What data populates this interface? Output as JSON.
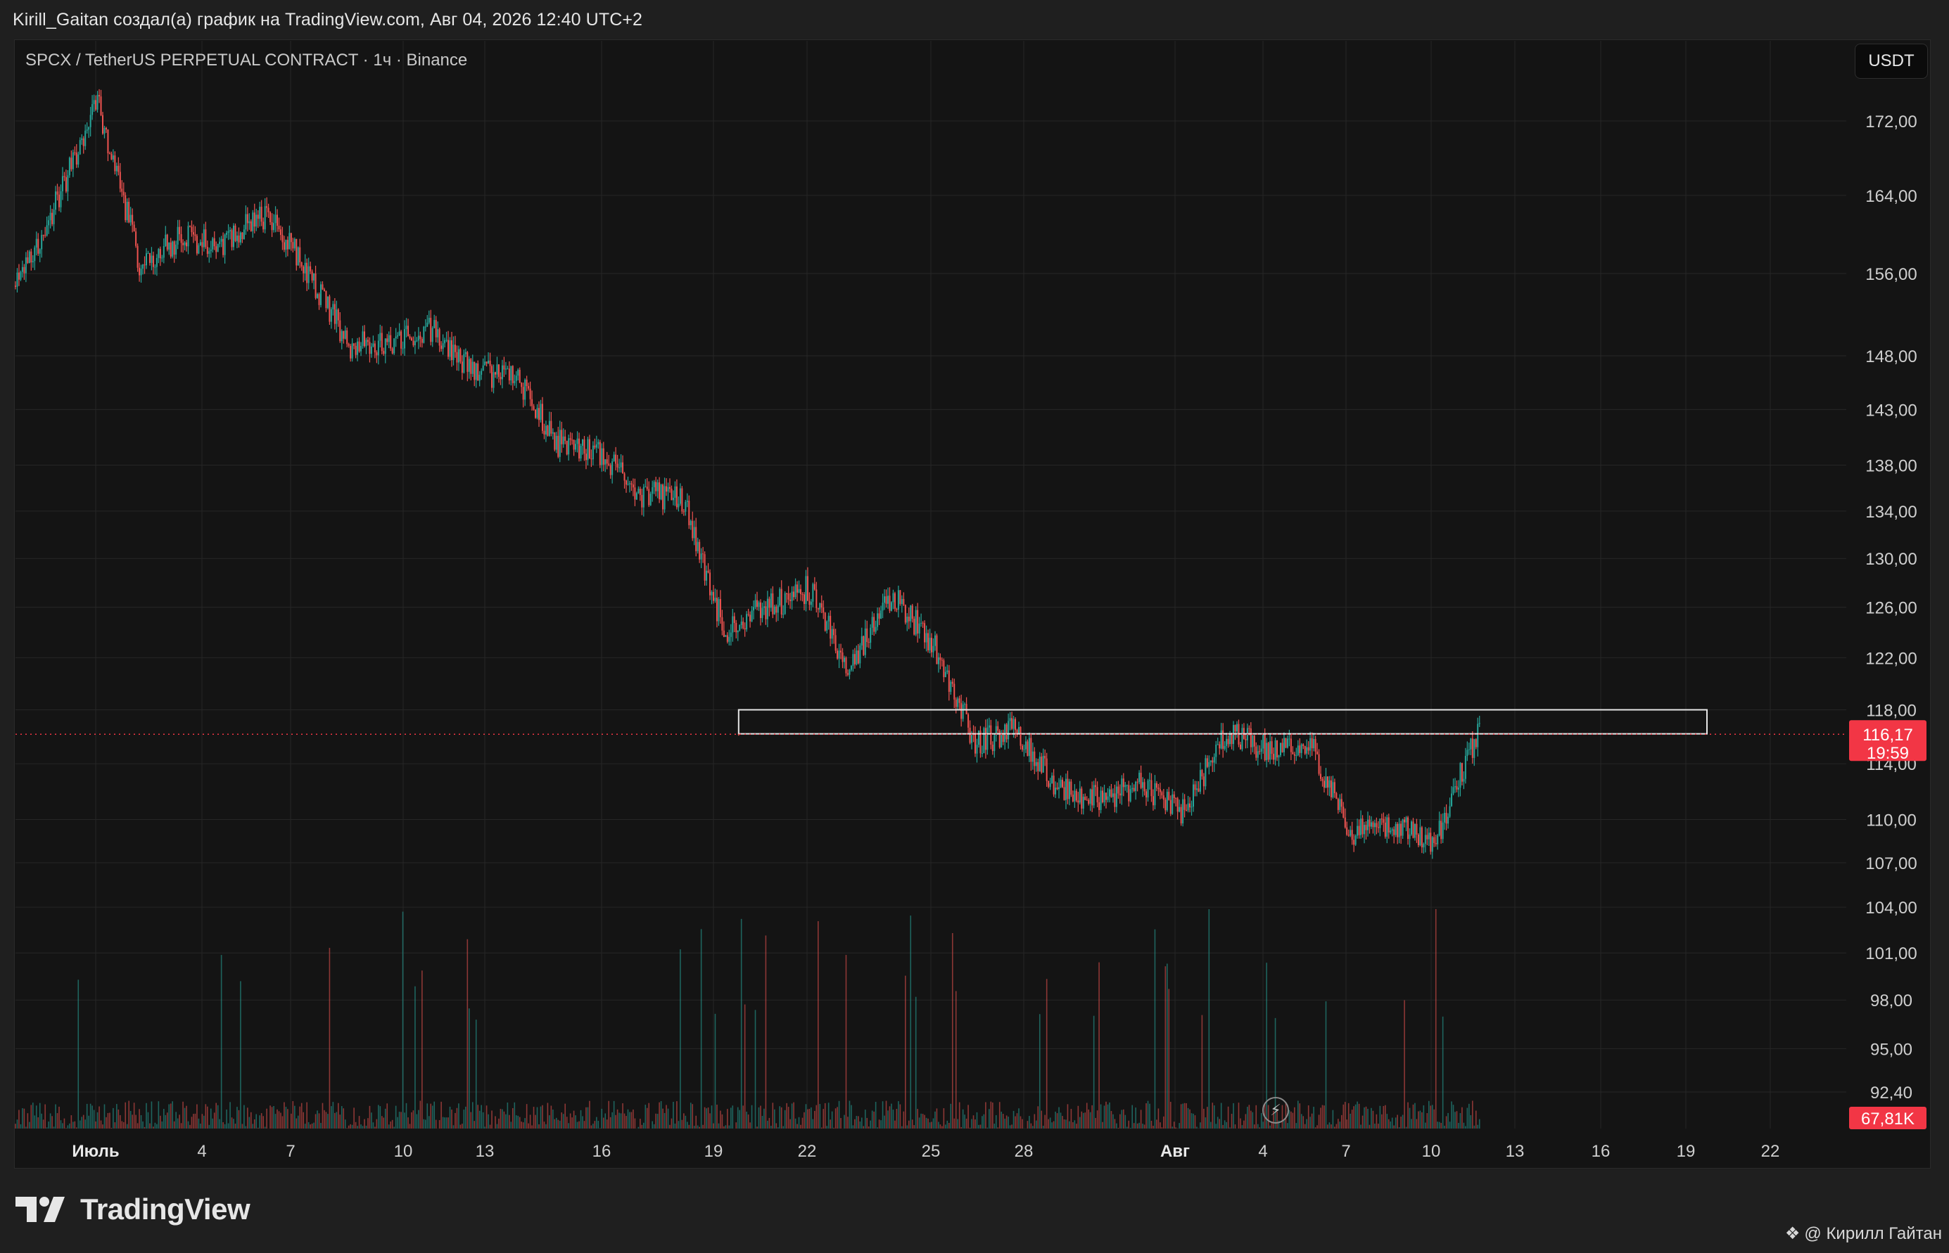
{
  "header": {
    "publisher_line": "Kirill_Gaitan создал(а) график на TradingView.com, Авг 04, 2026 12:40 UTC+2",
    "symbol_line": "SPCX / TetherUS PERPETUAL CONTRACT · 1ч · Binance",
    "currency_button": "USDT"
  },
  "price_axis": {
    "labels": [
      "172,00",
      "164,00",
      "156,00",
      "148,00",
      "143,00",
      "138,00",
      "134,00",
      "130,00",
      "126,00",
      "122,00",
      "118,00",
      "114,00",
      "110,00",
      "107,00",
      "104,00",
      "101,00",
      "98,00",
      "95,00",
      "92,40"
    ]
  },
  "time_axis": {
    "labels": [
      "Июль",
      "4",
      "7",
      "10",
      "13",
      "16",
      "19",
      "22",
      "25",
      "28",
      "Авг",
      "4",
      "7",
      "10",
      "13",
      "16",
      "19",
      "22"
    ]
  },
  "last_price": {
    "value": "116,17",
    "countdown": "19:59",
    "color": "#f23645"
  },
  "volume_badge": {
    "value": "67,81K",
    "color": "#f23645"
  },
  "colors": {
    "up": "#26a69a",
    "down": "#ef5350",
    "background": "#141414",
    "grid": "#262626"
  },
  "footer": {
    "brand": "TradingView",
    "author": "@ Кирилл Гайтан"
  },
  "chart_data": {
    "type": "candlestick",
    "symbol": "SPCX / TetherUS PERPETUAL CONTRACT",
    "interval": "1ч",
    "exchange": "Binance",
    "quote_currency": "USDT",
    "last_price": 116.17,
    "last_volume": "67,81K",
    "y_range": [
      92.4,
      176.0
    ],
    "price_scale": "log",
    "grid": true,
    "close_path": [
      {
        "date": "2026-06-30",
        "close": 154.5
      },
      {
        "date": "2026-07-01",
        "close": 163.0
      },
      {
        "date": "2026-07-02",
        "close": 174.0
      },
      {
        "date": "2026-07-03",
        "close": 157.0
      },
      {
        "date": "2026-07-04",
        "close": 159.5
      },
      {
        "date": "2026-07-05",
        "close": 159.0
      },
      {
        "date": "2026-07-06",
        "close": 162.0
      },
      {
        "date": "2026-07-07",
        "close": 156.5
      },
      {
        "date": "2026-07-08",
        "close": 149.0
      },
      {
        "date": "2026-07-09",
        "close": 149.5
      },
      {
        "date": "2026-07-10",
        "close": 150.5
      },
      {
        "date": "2026-07-11",
        "close": 146.5
      },
      {
        "date": "2026-07-12",
        "close": 146.0
      },
      {
        "date": "2026-07-13",
        "close": 140.0
      },
      {
        "date": "2026-07-14",
        "close": 139.0
      },
      {
        "date": "2026-07-15",
        "close": 135.5
      },
      {
        "date": "2026-07-16",
        "close": 135.0
      },
      {
        "date": "2026-07-17",
        "close": 124.0
      },
      {
        "date": "2026-07-18",
        "close": 126.0
      },
      {
        "date": "2026-07-19",
        "close": 127.5
      },
      {
        "date": "2026-07-20",
        "close": 121.0
      },
      {
        "date": "2026-07-21",
        "close": 127.0
      },
      {
        "date": "2026-07-22",
        "close": 123.0
      },
      {
        "date": "2026-07-23",
        "close": 115.5
      },
      {
        "date": "2026-07-24",
        "close": 116.5
      },
      {
        "date": "2026-07-25",
        "close": 112.0
      },
      {
        "date": "2026-07-26",
        "close": 111.5
      },
      {
        "date": "2026-07-27",
        "close": 112.5
      },
      {
        "date": "2026-07-28",
        "close": 110.5
      },
      {
        "date": "2026-07-29",
        "close": 116.5
      },
      {
        "date": "2026-07-30",
        "close": 115.0
      },
      {
        "date": "2026-07-31",
        "close": 115.5
      },
      {
        "date": "2026-08-01",
        "close": 109.0
      },
      {
        "date": "2026-08-02",
        "close": 109.5
      },
      {
        "date": "2026-08-03",
        "close": 108.5
      },
      {
        "date": "2026-08-04",
        "close": 116.17
      }
    ],
    "zone": {
      "low": 116.2,
      "high": 118.0,
      "from": "2026-07-17",
      "to": "2026-08-09"
    }
  }
}
